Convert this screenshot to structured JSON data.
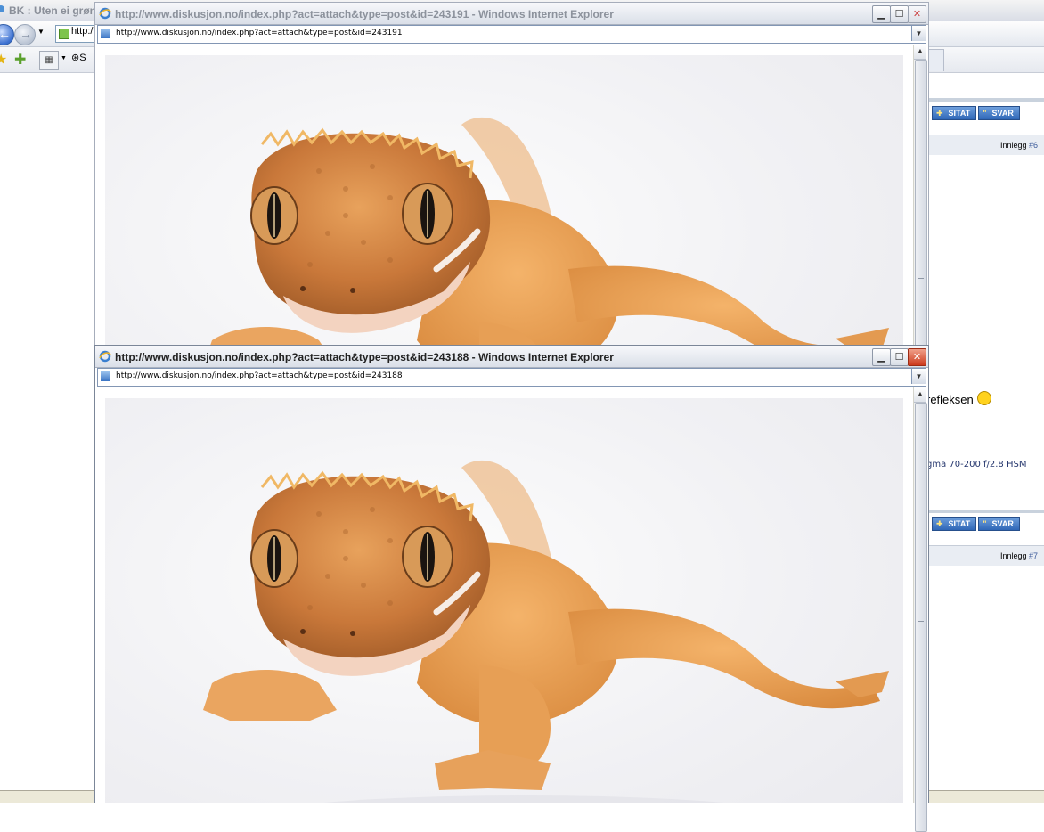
{
  "background_window": {
    "title": "BK : Uten ei grøn",
    "address_snippet": "http:/",
    "search_snippet": "S",
    "right_panel": {
      "buttons": [
        "SITAT",
        "SVAR"
      ],
      "post_label_1": "Innlegg",
      "post_number_1": "#6",
      "snippet_text": "refleksen",
      "gear_text": "gma 70-200 f/2.8 HSM",
      "post_label_2": "Innlegg",
      "post_number_2": "#7"
    }
  },
  "popup_top": {
    "title": "http://www.diskusjon.no/index.php?act=attach&type=post&id=243191 - Windows Internet Explorer",
    "url": "http://www.diskusjon.no/index.php?act=attach&type=post&id=243191"
  },
  "popup_bottom": {
    "title": "http://www.diskusjon.no/index.php?act=attach&type=post&id=243188 - Windows Internet Explorer",
    "url": "http://www.diskusjon.no/index.php?act=attach&type=post&id=243188"
  },
  "icons": [
    "ie-icon",
    "back-arrow-icon",
    "forward-arrow-icon",
    "favorites-star-icon",
    "add-favorites-icon",
    "tabs-grid-icon",
    "minimize-icon",
    "maximize-icon",
    "close-icon",
    "dropdown-arrow-icon",
    "smiley-icon"
  ]
}
